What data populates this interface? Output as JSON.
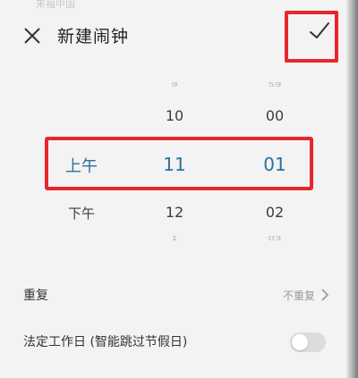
{
  "header": {
    "status_hint": "来福中国",
    "title": "新建闹钟",
    "close_icon": "close-icon",
    "confirm_icon": "check-icon"
  },
  "picker": {
    "ampm": [
      "",
      "",
      "上午",
      "下午",
      ""
    ],
    "hours": [
      "9",
      "10",
      "11",
      "12",
      "1"
    ],
    "minutes": [
      "59",
      "00",
      "01",
      "02",
      "03"
    ],
    "selected_color": "#2e6f97"
  },
  "settings": {
    "repeat": {
      "label": "重复",
      "value": "不重复"
    },
    "holiday": {
      "label": "法定工作日 (智能跳过节假日)",
      "enabled": false
    }
  },
  "annotation_color": "#e8262c"
}
